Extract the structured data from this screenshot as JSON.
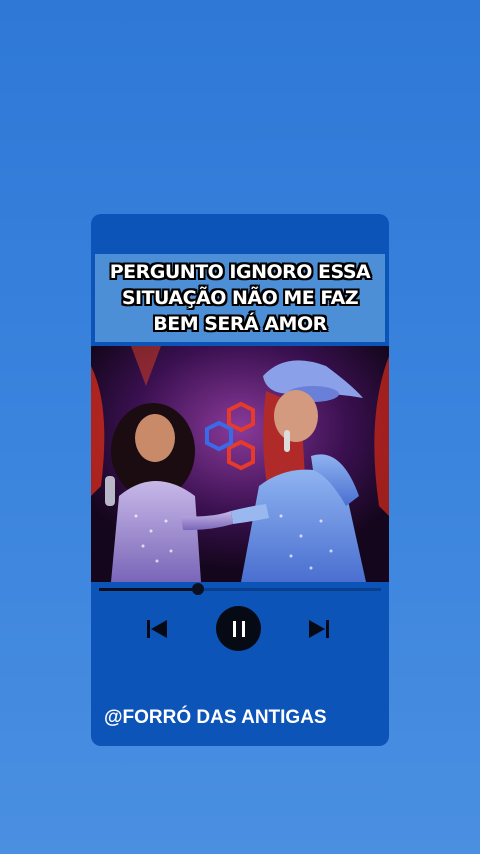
{
  "player": {
    "lyric_text": "PERGUNTO IGNORO ESSA\nSITUAÇÃO NÃO ME FAZ\nBEM SERÁ AMOR",
    "progress": 0.35,
    "footer_label": "@FORRÓ DAS ANTIGAS",
    "controls": {
      "previous_icon": "skip-previous-icon",
      "pause_icon": "pause-icon",
      "next_icon": "skip-next-icon"
    }
  },
  "colors": {
    "background": "#3a84de",
    "card": "#0d54b8",
    "lyric_box": "#4d8fd6",
    "button": "#050a14"
  }
}
